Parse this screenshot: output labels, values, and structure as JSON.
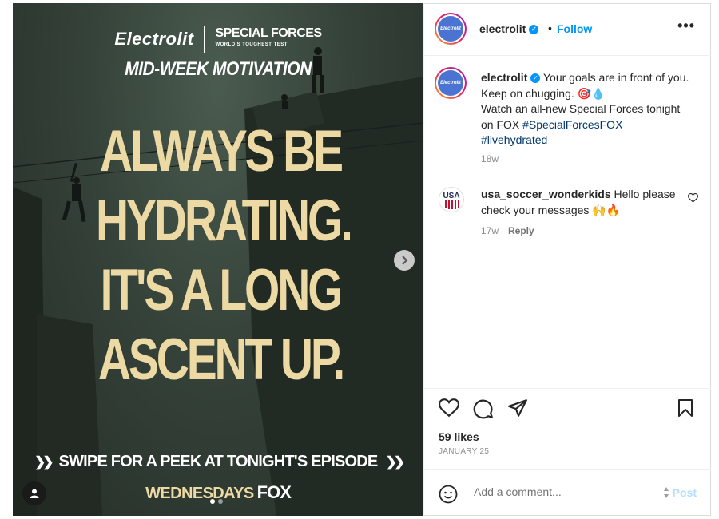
{
  "post": {
    "brand_logo": "Electrolit",
    "show_title": "SPECIAL FORCES",
    "show_subtitle": "WORLD'S TOUGHEST TEST",
    "series_title": "MID-WEEK MOTIVATION",
    "headline_lines": [
      "ALWAYS BE",
      "HYDRATING.",
      "IT'S A LONG",
      "ASCENT UP."
    ],
    "swipe_text": "SWIPE FOR A PEEK AT TONIGHT'S EPISODE",
    "airtime_text": "WEDNESDAYS",
    "network": "FOX",
    "carousel": {
      "count": 2,
      "active": 0
    }
  },
  "header": {
    "avatar_text": "Electrolit",
    "username": "electrolit",
    "separator": "•",
    "follow_label": "Follow",
    "more_label": "•••"
  },
  "caption": {
    "username": "electrolit",
    "line1": "Your goals are in front of you. Keep on chugging. 🎯💧",
    "line2": "Watch an all-new Special Forces tonight on FOX ",
    "hashtag1": "#SpecialForcesFOX",
    "hashtag2": "#livehydrated",
    "time": "18w"
  },
  "comments": [
    {
      "username": "usa_soccer_wonderkids",
      "text": "Hello please check your messages 🙌🔥",
      "avatar_text": "USA",
      "time": "17w",
      "reply_label": "Reply"
    }
  ],
  "stats": {
    "likes": "59 likes",
    "date": "JANUARY 25"
  },
  "add_comment": {
    "placeholder": "Add a comment...",
    "post_label": "Post"
  },
  "colors": {
    "accent": "#0095f6",
    "headline": "#ecd9a4",
    "hashtag": "#00376b"
  }
}
